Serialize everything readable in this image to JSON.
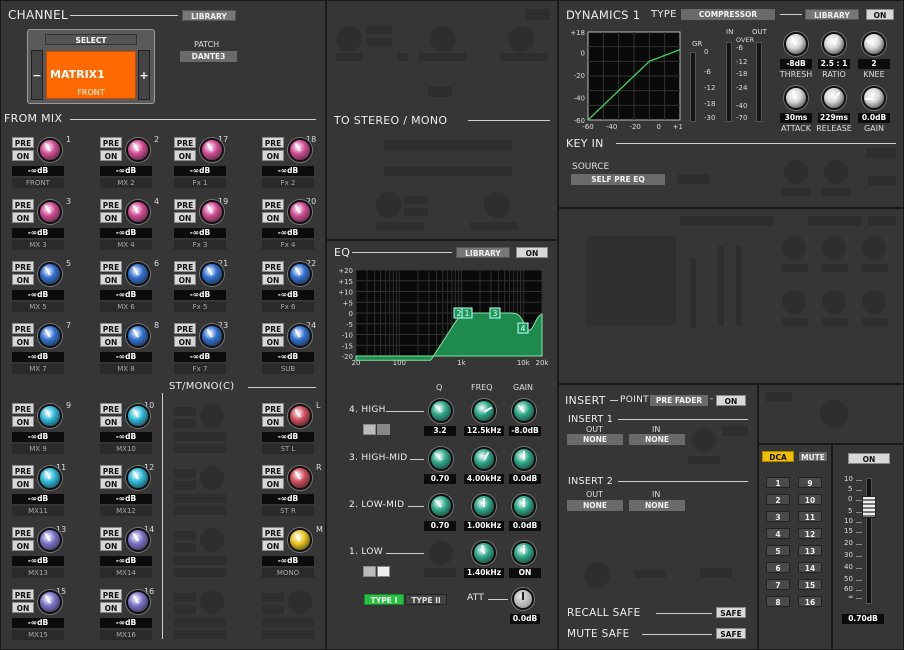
{
  "channel": {
    "title": "CHANNEL",
    "library_label": "LIBRARY",
    "select_label": "SELECT",
    "name": "MATRIX1",
    "sub": "FRONT",
    "prev": "−",
    "next": "+",
    "patch_label": "PATCH",
    "patch_value": "DANTE3"
  },
  "from_mix": {
    "title": "FROM MIX",
    "pre_label": "PRE",
    "on_label": "ON",
    "cells": [
      {
        "num": "1",
        "level": "-∞dB",
        "name": "FRONT",
        "color": "#d04a92"
      },
      {
        "num": "2",
        "level": "-∞dB",
        "name": "MX 2",
        "color": "#d04a92"
      },
      {
        "num": "17",
        "level": "-∞dB",
        "name": "Fx 1",
        "color": "#d04a92"
      },
      {
        "num": "18",
        "level": "-∞dB",
        "name": "Fx 2",
        "color": "#d04a92"
      },
      {
        "num": "3",
        "level": "-∞dB",
        "name": "MX 3",
        "color": "#d04a92"
      },
      {
        "num": "4",
        "level": "-∞dB",
        "name": "MX 4",
        "color": "#d04a92"
      },
      {
        "num": "19",
        "level": "-∞dB",
        "name": "Fx 3",
        "color": "#d04a92"
      },
      {
        "num": "20",
        "level": "-∞dB",
        "name": "Fx 4",
        "color": "#d04a92"
      },
      {
        "num": "5",
        "level": "-∞dB",
        "name": "MX 5",
        "color": "#2f6fd0"
      },
      {
        "num": "6",
        "level": "-∞dB",
        "name": "MX 6",
        "color": "#2f6fd0"
      },
      {
        "num": "21",
        "level": "-∞dB",
        "name": "Fx 5",
        "color": "#2f6fd0"
      },
      {
        "num": "22",
        "level": "-∞dB",
        "name": "Fx 6",
        "color": "#2f6fd0"
      },
      {
        "num": "7",
        "level": "-∞dB",
        "name": "MX 7",
        "color": "#2f6fd0"
      },
      {
        "num": "8",
        "level": "-∞dB",
        "name": "MX 8",
        "color": "#2f6fd0"
      },
      {
        "num": "23",
        "level": "-∞dB",
        "name": "Fx 7",
        "color": "#2f6fd0"
      },
      {
        "num": "24",
        "level": "-∞dB",
        "name": "SUB",
        "color": "#2f6fd0"
      },
      {
        "num": "9",
        "level": "-∞dB",
        "name": "MX 9",
        "color": "#2ab8d8"
      },
      {
        "num": "10",
        "level": "-∞dB",
        "name": "MX10",
        "color": "#2ab8d8"
      },
      {
        "num": "L",
        "level": "-∞dB",
        "name": "ST L",
        "color": "#d04a5a"
      },
      {
        "num": "11",
        "level": "-∞dB",
        "name": "MX11",
        "color": "#2ab8d8"
      },
      {
        "num": "12",
        "level": "-∞dB",
        "name": "MX12",
        "color": "#2ab8d8"
      },
      {
        "num": "R",
        "level": "-∞dB",
        "name": "ST R",
        "color": "#d04a5a"
      },
      {
        "num": "13",
        "level": "-∞dB",
        "name": "MX13",
        "color": "#7a72c8"
      },
      {
        "num": "14",
        "level": "-∞dB",
        "name": "MX14",
        "color": "#7a72c8"
      },
      {
        "num": "M",
        "level": "-∞dB",
        "name": "MONO",
        "color": "#e8c21c"
      },
      {
        "num": "15",
        "level": "-∞dB",
        "name": "MX15",
        "color": "#7a72c8"
      },
      {
        "num": "16",
        "level": "-∞dB",
        "name": "MX16",
        "color": "#7a72c8"
      }
    ]
  },
  "st_mono": {
    "title": "ST/MONO(C)"
  },
  "to_stereo": {
    "title": "TO STEREO / MONO"
  },
  "eq": {
    "title": "EQ",
    "library_label": "LIBRARY",
    "on_label": "ON",
    "y_ticks": [
      "+20",
      "+15",
      "+10",
      "+5",
      "0",
      "-5",
      "-10",
      "-15",
      "-20"
    ],
    "x_ticks": [
      "20",
      "100",
      "1k",
      "10k",
      "20k"
    ],
    "markers": [
      "2",
      "1",
      "3",
      "4"
    ],
    "col_q": "Q",
    "col_freq": "FREQ",
    "col_gain": "GAIN",
    "bands": [
      {
        "name": "4. HIGH",
        "q": "3.2",
        "freq": "12.5kHz",
        "gain": "-8.0dB"
      },
      {
        "name": "3. HIGH-MID",
        "q": "0.70",
        "freq": "4.00kHz",
        "gain": "0.0dB"
      },
      {
        "name": "2. LOW-MID",
        "q": "0.70",
        "freq": "1.00kHz",
        "gain": "0.0dB"
      },
      {
        "name": "1. LOW",
        "q": "",
        "freq": "1.40kHz",
        "gain": "ON"
      }
    ],
    "type1": "TYPE I",
    "type2": "TYPE II",
    "att_label": "ATT",
    "att_value": "0.0dB"
  },
  "dynamics": {
    "title": "DYNAMICS 1",
    "type_label": "TYPE",
    "type_value": "COMPRESSOR",
    "library_label": "LIBRARY",
    "on_label": "ON",
    "graph_y": [
      "+18",
      "0",
      "-20",
      "-40",
      "-60"
    ],
    "graph_x": [
      "-60",
      "-40",
      "-20",
      "0",
      "+18"
    ],
    "gr_label": "GR",
    "gr_ticks": [
      "0",
      "-6",
      "-12",
      "-18",
      "-30"
    ],
    "in_label": "IN",
    "out_label": "OUT",
    "over_label": "OVER",
    "io_ticks": [
      "-6",
      "-12",
      "-18",
      "-24",
      "-40",
      "-70"
    ],
    "thresh_value": "-8dB",
    "ratio_value": "2.5 : 1",
    "knee_value": "2",
    "thresh_label": "THRESH",
    "ratio_label": "RATIO",
    "knee_label": "KNEE",
    "attack_value": "30ms",
    "release_value": "229ms",
    "gain_value": "0.0dB",
    "attack_label": "ATTACK",
    "release_label": "RELEASE",
    "gain_label": "GAIN"
  },
  "key_in": {
    "title": "KEY IN",
    "source_label": "SOURCE",
    "source_value": "SELF PRE EQ"
  },
  "insert": {
    "title": "INSERT",
    "point_label": "POINT",
    "point_value": "PRE FADER",
    "dash": "-",
    "on_label": "ON",
    "insert1": "INSERT 1",
    "insert2": "INSERT 2",
    "out_label": "OUT",
    "in_label": "IN",
    "none": "NONE"
  },
  "recall_safe": {
    "label": "RECALL SAFE",
    "button": "SAFE"
  },
  "mute_safe": {
    "label": "MUTE SAFE",
    "button": "SAFE"
  },
  "dca": {
    "dca_label": "DCA",
    "mute_label": "MUTE",
    "groups": [
      "1",
      "9",
      "2",
      "10",
      "3",
      "11",
      "4",
      "12",
      "5",
      "13",
      "6",
      "14",
      "7",
      "15",
      "8",
      "16"
    ]
  },
  "fader": {
    "on_label": "ON",
    "scale": [
      "10",
      "5",
      "0",
      "5",
      "10",
      "15",
      "20",
      "30",
      "40",
      "50",
      "60",
      "∞"
    ],
    "level": "0.70dB"
  },
  "colors": {
    "accent_orange": "#ff6a00",
    "on_green": "#26c23f",
    "eq_fill": "#1f8a4e",
    "dca_yellow": "#f0c000"
  }
}
